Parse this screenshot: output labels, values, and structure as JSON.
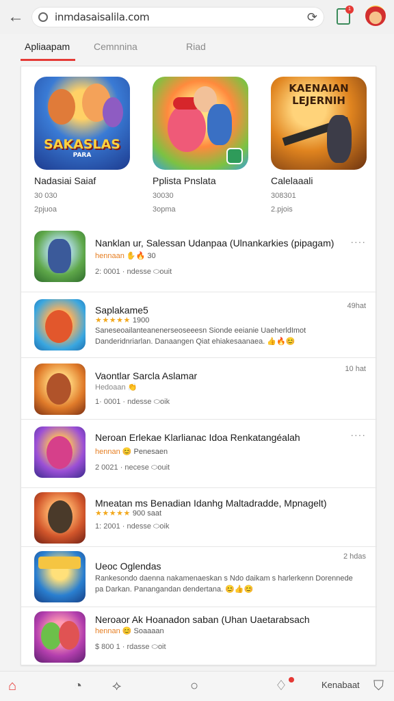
{
  "browser": {
    "url": "inmdasaisalila.com",
    "tabs_badge": "1"
  },
  "section_tabs": [
    "Apliaapam",
    "Cemnnina",
    "Riad"
  ],
  "featured": [
    {
      "art": "SAKASLAS",
      "art_sub": "PARA",
      "title": "Nadasiai Saiaf",
      "meta": "30 030",
      "sub": "2pjuoa"
    },
    {
      "art": "",
      "art_sub": "",
      "title": "Pplista Pnslata",
      "meta": "30030",
      "sub": "3opma"
    },
    {
      "art": "KAENAIAN LEJERNIH",
      "art_sub": "",
      "title": "Calelaaali",
      "meta": "308301",
      "sub": "2.pjois"
    }
  ],
  "list": [
    {
      "title": "Nanklan ur, Salessan Udanpaa (Ulnankarkies (pipagam)",
      "line2_prefix": "hennaan",
      "line2_emoji": "✋🔥",
      "line2_value": "30",
      "line3": "2: 0001 · ndesse ⬭ouit",
      "desc": "",
      "time": "",
      "more": "····"
    },
    {
      "title": "Saplakame5",
      "line2_prefix": "",
      "stars": "★★★★★",
      "line2_value": "1900",
      "line3": "",
      "desc": "Saneseoailanteanenerseoseeesn Sionde eeianie UaeherldImot Danderidnriarlan. Danaangen Qiat ehiakesaanaea. 👍🔥😊",
      "time": "49hat",
      "more": ""
    },
    {
      "title": "Vaontlar Sarcla Aslamar",
      "line2_prefix": "Hedoaan",
      "line2_emoji": "👏",
      "line2_value": "",
      "line3": "1· 0001 · ndesse ⬭oik",
      "desc": "",
      "time": "10 hat",
      "more": ""
    },
    {
      "title": "Neroan Erlekae Klarlianac Idoa Renkatangéalah",
      "line2_prefix": "hennan",
      "line2_emoji": "😊",
      "line2_value": "Penesaen",
      "line3": "2 0021 · necese ⬭ouit",
      "desc": "",
      "time": "",
      "more": "····"
    },
    {
      "title": "Mneatan ms Benadian Idanhg Maltadradde, Mpnagelt)",
      "line2_prefix": "",
      "stars": "★★★★★",
      "line2_value": "900 saat",
      "line3": "1: 2001 · ndesse ⬭oik",
      "desc": "",
      "time": "",
      "more": ""
    },
    {
      "title": "Ueoc Oglendas",
      "line2_prefix": "",
      "line2_value": "",
      "line3": "",
      "desc": "Rankesondo daenna nakamenaeskan s Ndo daikam s harlerkenn Dorennede pa Darkan. Panangandan dendertana. 😊👍😊",
      "time": "2 hdas",
      "more": ""
    },
    {
      "title": "Neroaor Ak Hoanadon saban (Uhan Uaetarabsach",
      "line2_prefix": "hennan",
      "line2_emoji": "😊",
      "line2_value": "Soaaaan",
      "line3": "$ 800 1 · rdasse ⬭oit",
      "desc": "",
      "time": "",
      "more": ""
    }
  ],
  "bottom_nav": {
    "home_icon": "home-icon",
    "label": "Kenabaat"
  }
}
